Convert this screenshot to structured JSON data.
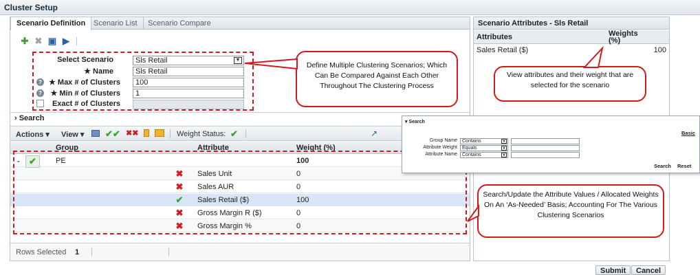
{
  "window": {
    "title": "Cluster Setup"
  },
  "tabs": [
    {
      "label": "Scenario Definition",
      "active": true
    },
    {
      "label": "Scenario List",
      "active": false
    },
    {
      "label": "Scenario Compare",
      "active": false
    }
  ],
  "toolbar_icons": [
    "add-icon",
    "delete-icon",
    "save-icon",
    "run-icon"
  ],
  "form": {
    "select_scenario": {
      "label": "Select Scenario",
      "value": "Sls Retail"
    },
    "name": {
      "label": "★ Name",
      "value": "Sls Retail"
    },
    "max_clusters": {
      "label": "★ Max # of Clusters",
      "value": "100"
    },
    "min_clusters": {
      "label": "★ Min # of Clusters",
      "value": "1"
    },
    "exact_clusters": {
      "label": "Exact # of Clusters",
      "value": ""
    }
  },
  "callouts": {
    "define": "Define Multiple Clustering Scenarios; Which Can Be Compared Against Each Other Throughout The Clustering Process",
    "view": "View attributes and their weight that are selected for the scenario",
    "search": "Search/Update the Attribute Values / Allocated Weights On An ‘As-Needed’ Basis; Accounting For The Various Clustering Scenarios"
  },
  "search_section": {
    "label": "›  Search"
  },
  "grid_toolbar": {
    "actions": "Actions ▾",
    "view": "View ▾",
    "weight_status_label": "Weight Status:"
  },
  "grid": {
    "columns": [
      "Group",
      "Attribute",
      "Weight (%)"
    ],
    "group_row": {
      "group": "PE",
      "weight": "100"
    },
    "rows": [
      {
        "attribute": "Sales Unit",
        "weight": "0",
        "status": "excluded"
      },
      {
        "attribute": "Sales AUR",
        "weight": "0",
        "status": "excluded"
      },
      {
        "attribute": "Sales Retail ($)",
        "weight": "100",
        "status": "included"
      },
      {
        "attribute": "Gross Margin R ($)",
        "weight": "0",
        "status": "excluded"
      },
      {
        "attribute": "Gross Margin %",
        "weight": "0",
        "status": "excluded"
      }
    ],
    "footer": {
      "rows_selected_label": "Rows Selected",
      "rows_selected_value": "1"
    }
  },
  "right_panel": {
    "title": "Scenario Attributes - Sls Retail",
    "columns": [
      "Attributes",
      "Weights (%)"
    ],
    "rows": [
      {
        "attribute": "Sales Retail ($)",
        "weight": "100"
      }
    ]
  },
  "search_popup": {
    "title": "▾ Search",
    "basic": "Basic",
    "fields": [
      {
        "label": "Group Name",
        "op": "Contains"
      },
      {
        "label": "Attribute Weight",
        "op": "Equals"
      },
      {
        "label": "Attribute Name",
        "op": "Contains"
      }
    ],
    "search_btn": "Search",
    "reset_btn": "Reset"
  },
  "buttons": {
    "submit": "Submit",
    "cancel": "Cancel"
  },
  "colors": {
    "accent_red": "#d21a1a",
    "check_green": "#3aa12d",
    "selected_row": "#d6e6f6"
  }
}
